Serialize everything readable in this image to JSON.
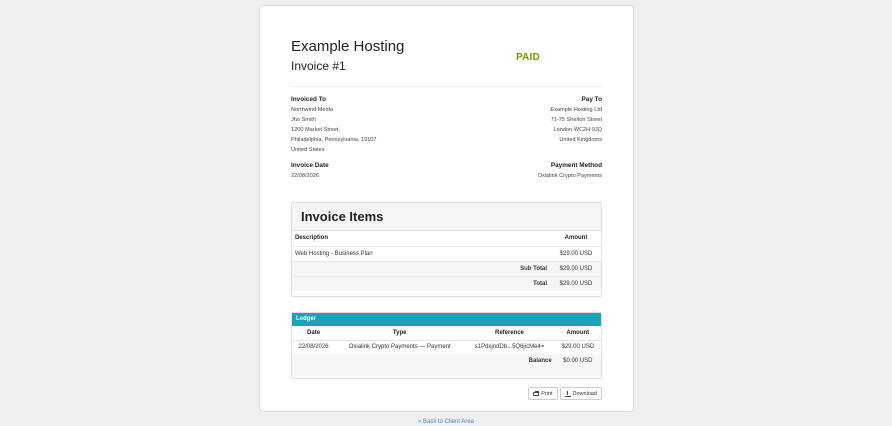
{
  "header": {
    "company": "Example Hosting",
    "invoice_title": "Invoice #1",
    "status": "PAID"
  },
  "invoiced_to": {
    "heading": "Invoiced To",
    "lines": [
      "Northwind Media",
      "Jho Smith",
      "1200 Market Street,",
      "Philadelphia, Pennsylvania, 19107",
      "United States"
    ]
  },
  "pay_to": {
    "heading": "Pay To",
    "lines": [
      "Example Hosting Ltd",
      "71-75 Shelton Street",
      "London WC2H 9JQ",
      "United Kingdoms"
    ]
  },
  "invoice_date": {
    "heading": "Invoice Date",
    "value": "22/08/2026"
  },
  "payment_method": {
    "heading": "Payment Method",
    "value": "Oxialink Crypto Payments"
  },
  "items": {
    "title": "Invoice Items",
    "col_description": "Description",
    "col_amount": "Amount",
    "rows": [
      {
        "description": "Web Hosting - Business Plan",
        "amount": "$29.00 USD"
      }
    ],
    "subtotal_label": "Sub Total",
    "subtotal": "$29.00 USD",
    "total_label": "Total",
    "total": "$29.00 USD"
  },
  "ledger": {
    "title": "Ledger",
    "cols": [
      "Date",
      "Type",
      "Reference",
      "Amount"
    ],
    "rows": [
      {
        "date": "22/08/2026",
        "type": "Oxialink Crypto Payments — Payment",
        "reference": "s1PdxjndDb...5Q6jicMe4=",
        "amount": "$29.00 USD"
      }
    ],
    "balance_label": "Balance",
    "balance": "$0.00 USD"
  },
  "buttons": {
    "print": "Print",
    "download": "Download"
  },
  "back_link": "« Back to Client Area",
  "colors": {
    "paid": "#779500",
    "ledger_header": "#1ba1b8"
  }
}
